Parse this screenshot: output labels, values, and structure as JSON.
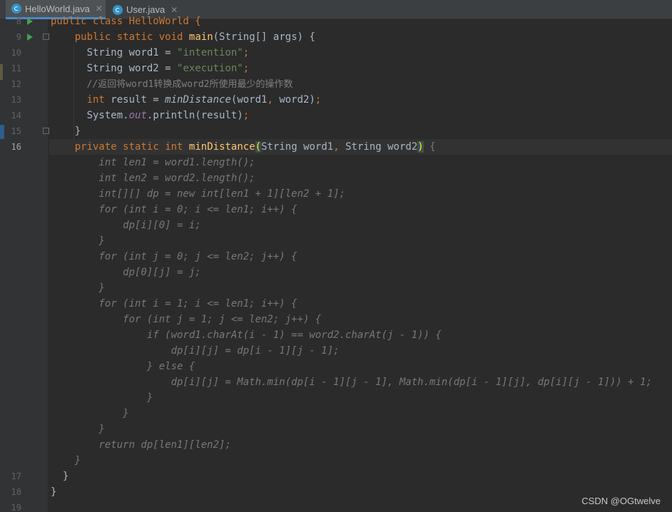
{
  "tabs": [
    {
      "label": "HelloWorld.java",
      "active": true,
      "close": "✕"
    },
    {
      "label": "User.java",
      "active": false,
      "close": "✕"
    }
  ],
  "gutter": {
    "line_numbers": [
      "8",
      "9",
      "10",
      "11",
      "12",
      "13",
      "14",
      "15",
      "16",
      "17",
      "18",
      "19"
    ],
    "current_line": "16"
  },
  "code": {
    "l8_class": "public class HelloWorld {",
    "l9_public": "public",
    "l9_static": "static",
    "l9_void": "void",
    "l9_main": "main",
    "l9_rest": "(String[] args) {",
    "l10_a": "String word1 = ",
    "l10_str": "\"intention\"",
    "l10_semi": ";",
    "l11_a": "String word2 = ",
    "l11_str": "\"execution\"",
    "l11_semi": ";",
    "l12_comment": "//返回将word1转换成word2所使用最少的操作数",
    "l13_int": "int",
    "l13_a": " result = ",
    "l13_call": "minDistance",
    "l13_b": "(word1",
    "l13_c": ", ",
    "l13_d": "word2)",
    "l13_semi": ";",
    "l14_a": "System.",
    "l14_out": "out",
    "l14_b": ".println(result)",
    "l14_semi": ";",
    "l15_brace": "}",
    "l16_private": "private",
    "l16_static": "static",
    "l16_int": "int",
    "l16_name": "minDistance",
    "l16_open": "(",
    "l16_params_a": "String word1",
    "l16_comma": ",",
    "l16_params_b": " String word2",
    "l16_close": ")",
    "l16_brace": " {",
    "fold_lines": [
      "    int len1 = word1.length();",
      "    int len2 = word2.length();",
      "    int[][] dp = new int[len1 + 1][len2 + 1];",
      "    for (int i = 0; i <= len1; i++) {",
      "        dp[i][0] = i;",
      "    }",
      "    for (int j = 0; j <= len2; j++) {",
      "        dp[0][j] = j;",
      "    }",
      "    for (int i = 1; i <= len1; i++) {",
      "        for (int j = 1; j <= len2; j++) {",
      "            if (word1.charAt(i - 1) == word2.charAt(j - 1)) {",
      "                dp[i][j] = dp[i - 1][j - 1];",
      "            } else {",
      "                dp[i][j] = Math.min(dp[i - 1][j - 1], Math.min(dp[i - 1][j], dp[i][j - 1])) + 1;",
      "            }",
      "        }",
      "    }",
      "    return dp[len1][len2];",
      "}"
    ],
    "l17_brace": "}",
    "l18_brace": "}"
  },
  "watermark": "CSDN @OGtwelve",
  "colors": {
    "background": "#2b2b2b",
    "keyword": "#cc7832",
    "string": "#6a8759",
    "method": "#ffc66d",
    "static_field": "#9876aa",
    "comment": "#808080",
    "plain": "#a9b7c6"
  }
}
